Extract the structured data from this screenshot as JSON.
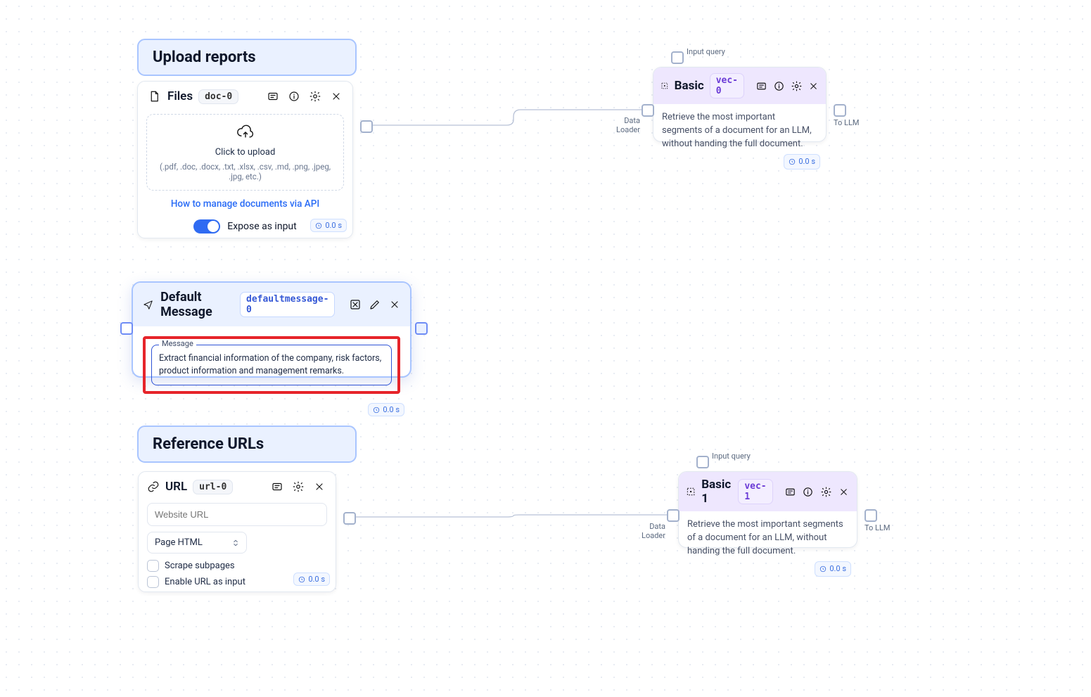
{
  "titles": {
    "upload_reports": "Upload reports",
    "reference_urls": "Reference URLs"
  },
  "files": {
    "title": "Files",
    "badge": "doc-0",
    "upload_main": "Click to upload",
    "upload_sub": "(.pdf, .doc, .docx, .txt, .xlsx, .csv, .md, .png, .jpeg, .jpg, etc.)",
    "api_link": "How to manage documents via API",
    "expose_label": "Expose as input",
    "time": "0.0 s"
  },
  "default_message": {
    "title": "Default Message",
    "badge": "defaultmessage-0",
    "legend": "Message",
    "text": "Extract financial information of the company, risk factors, product information and management remarks.",
    "time": "0.0 s"
  },
  "url": {
    "title": "URL",
    "badge": "url-0",
    "placeholder": "Website URL",
    "select_value": "Page HTML",
    "check_scrape": "Scrape subpages",
    "check_enable": "Enable URL as input",
    "time": "0.0 s"
  },
  "basic1": {
    "title": "Basic",
    "badge": "vec-0",
    "description": "Retrieve the most important segments of a document for an LLM, without handing the full document.",
    "time": "0.0 s",
    "input_label": "Input query",
    "dl_label1": "Data",
    "dl_label2": "Loader",
    "out_label": "To LLM"
  },
  "basic2": {
    "title": "Basic 1",
    "badge": "vec-1",
    "description": "Retrieve the most important segments of a document for an LLM, without handing the full document.",
    "time": "0.0 s",
    "input_label": "Input query",
    "dl_label1": "Data",
    "dl_label2": "Loader",
    "out_label": "To LLM"
  }
}
